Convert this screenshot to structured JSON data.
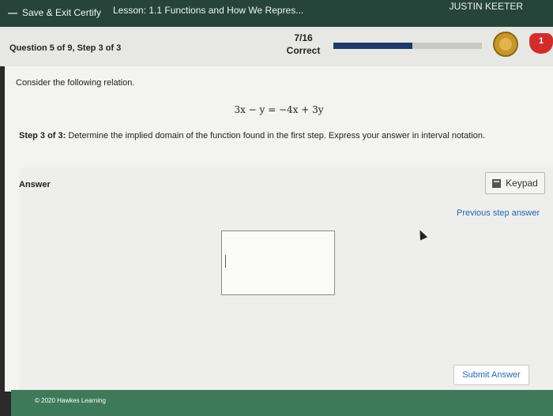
{
  "topbar": {
    "save_exit_label": "Save & Exit Certify",
    "lesson_label": "Lesson: 1.1 Functions and How We Repres...",
    "user_name": "JUSTIN KEETER"
  },
  "question_bar": {
    "question_title": "Question 5 of 9, Step 3 of 3",
    "score": "7/16",
    "status": "Correct",
    "progress_fraction": 0.53,
    "hearts_count": "1"
  },
  "content": {
    "prompt": "Consider the following relation.",
    "equation": "3x − y = −4x + 3y",
    "step_label": "Step 3 of 3",
    "step_text": "Determine the implied domain of the function found in the first step. Express your answer in interval notation."
  },
  "answer": {
    "label": "Answer",
    "keypad_label": "Keypad",
    "previous_step_label": "Previous step answer",
    "input_value": "",
    "submit_label": "Submit Answer"
  },
  "footer": {
    "copyright": "© 2020 Hawkes Learning"
  },
  "colors": {
    "topbar_bg": "#26443a",
    "progress_fill": "#1f3a6a",
    "link_blue": "#2566b0",
    "footer_bg": "#3e7a5a",
    "heart_red": "#d12d2d",
    "medal_gold": "#c7962a"
  },
  "icons": {
    "save_exit": "arrow-left-icon",
    "medal": "medal-icon",
    "hearts": "heart-icon",
    "keypad": "calculator-icon"
  }
}
